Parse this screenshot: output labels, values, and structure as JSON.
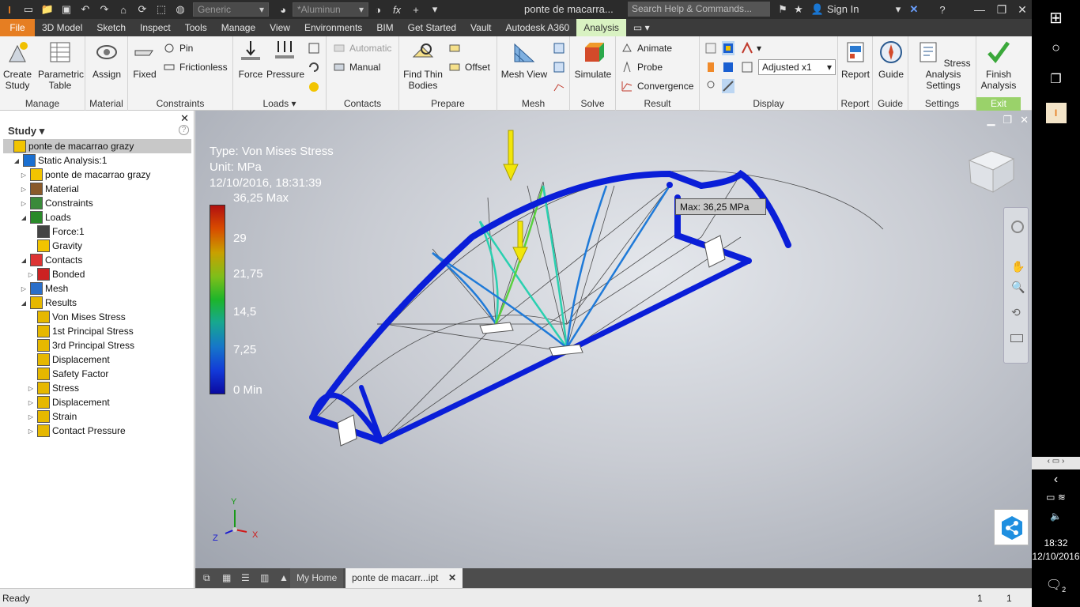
{
  "app": {
    "window_title": "ponte de macarra...",
    "search_placeholder": "Search Help & Commands...",
    "sign_in": "Sign In",
    "material_select": "Generic",
    "appearance_select": "*Aluminun"
  },
  "menu_tabs": [
    "File",
    "3D Model",
    "Sketch",
    "Inspect",
    "Tools",
    "Manage",
    "View",
    "Environments",
    "BIM",
    "Get Started",
    "Vault",
    "Autodesk A360",
    "Analysis"
  ],
  "ribbon": {
    "manage": {
      "title": "Manage",
      "create_study": "Create Study",
      "parametric_table": "Parametric Table"
    },
    "material": {
      "title": "Material",
      "assign": "Assign"
    },
    "constraints": {
      "title": "Constraints",
      "fixed": "Fixed",
      "pin": "Pin",
      "frictionless": "Frictionless"
    },
    "loads": {
      "title": "Loads",
      "force": "Force",
      "pressure": "Pressure"
    },
    "contacts": {
      "title": "Contacts",
      "automatic": "Automatic",
      "manual": "Manual"
    },
    "prepare": {
      "title": "Prepare",
      "find_thin_bodies": "Find Thin Bodies",
      "offset": "Offset"
    },
    "mesh": {
      "title": "Mesh",
      "mesh_view": "Mesh View"
    },
    "solve": {
      "title": "Solve",
      "simulate": "Simulate"
    },
    "result": {
      "title": "Result",
      "animate": "Animate",
      "probe": "Probe",
      "convergence": "Convergence"
    },
    "display": {
      "title": "Display",
      "adjusted": "Adjusted x1"
    },
    "report": {
      "title": "Report",
      "report": "Report"
    },
    "guide": {
      "title": "Guide",
      "guide": "Guide"
    },
    "settings": {
      "title": "Settings",
      "stress_analysis_settings": "Stress Analysis Settings"
    },
    "exit": {
      "title": "Exit",
      "finish_analysis": "Finish Analysis"
    }
  },
  "browser": {
    "title": "Study",
    "items": [
      {
        "label": "ponte de macarrao grazy",
        "level": 0,
        "twisty": ""
      },
      {
        "label": "Static Analysis:1",
        "level": 0,
        "twisty": "◢"
      },
      {
        "label": "ponte de macarrao grazy",
        "level": 1,
        "twisty": "▷"
      },
      {
        "label": "Material",
        "level": 1,
        "twisty": "▷"
      },
      {
        "label": "Constraints",
        "level": 1,
        "twisty": "▷"
      },
      {
        "label": "Loads",
        "level": 1,
        "twisty": "◢"
      },
      {
        "label": "Force:1",
        "level": 2,
        "twisty": ""
      },
      {
        "label": "Gravity",
        "level": 2,
        "twisty": ""
      },
      {
        "label": "Contacts",
        "level": 1,
        "twisty": "◢"
      },
      {
        "label": "Bonded",
        "level": 2,
        "twisty": "▷"
      },
      {
        "label": "Mesh",
        "level": 1,
        "twisty": "▷"
      },
      {
        "label": "Results",
        "level": 1,
        "twisty": "◢"
      },
      {
        "label": "Von Mises Stress",
        "level": 2,
        "twisty": ""
      },
      {
        "label": "1st Principal Stress",
        "level": 2,
        "twisty": ""
      },
      {
        "label": "3rd Principal Stress",
        "level": 2,
        "twisty": ""
      },
      {
        "label": "Displacement",
        "level": 2,
        "twisty": ""
      },
      {
        "label": "Safety Factor",
        "level": 2,
        "twisty": ""
      },
      {
        "label": "Stress",
        "level": 2,
        "twisty": "▷"
      },
      {
        "label": "Displacement",
        "level": 2,
        "twisty": "▷"
      },
      {
        "label": "Strain",
        "level": 2,
        "twisty": "▷"
      },
      {
        "label": "Contact Pressure",
        "level": 2,
        "twisty": "▷"
      }
    ]
  },
  "legend": {
    "type": "Type: Von Mises Stress",
    "unit": "Unit: MPa",
    "timestamp": "12/10/2016, 18:31:39",
    "ticks": [
      "36,25 Max",
      "29",
      "21,75",
      "14,5",
      "7,25",
      "0 Min"
    ]
  },
  "probe_label": "Max: 36,25 MPa",
  "axes": {
    "x": "X",
    "y": "Y",
    "z": "Z"
  },
  "doc_tabs": {
    "home": "My Home",
    "document": "ponte de macarr...ipt"
  },
  "status": {
    "text": "Ready",
    "count1": "1",
    "count2": "1"
  },
  "taskbar": {
    "time": "18:32",
    "date": "12/10/2016",
    "notifications": "2"
  }
}
